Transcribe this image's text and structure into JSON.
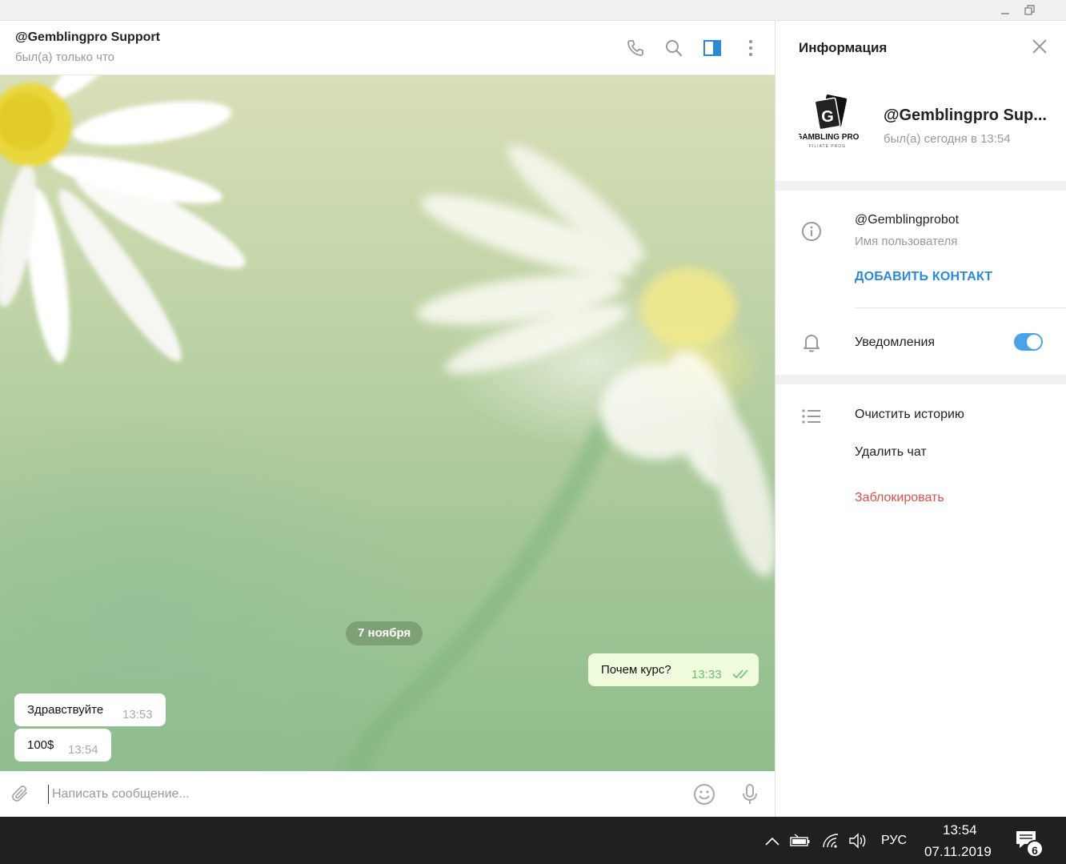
{
  "window": {
    "controls": [
      "minimize-icon",
      "restore-icon"
    ]
  },
  "header": {
    "title": "@Gemblingpro Support",
    "status": "был(а) только что",
    "icons": [
      "phone-icon",
      "search-icon",
      "sidebar-toggle-icon",
      "more-vertical-icon"
    ],
    "accent_color": "#2b8ad8"
  },
  "chat": {
    "date_label": "7 ноября",
    "messages": [
      {
        "direction": "out",
        "text": "Почем курс?",
        "time": "13:33",
        "status": "double-check-icon"
      },
      {
        "direction": "in",
        "text": "Здравствуйте",
        "time": "13:53"
      },
      {
        "direction": "in",
        "text": "100$",
        "time": "13:54"
      }
    ]
  },
  "compose": {
    "placeholder": "Написать сообщение...",
    "icons": [
      "attach-icon",
      "emoji-icon",
      "microphone-icon"
    ]
  },
  "info": {
    "title": "Информация",
    "profile": {
      "name": "@Gemblingpro Sup...",
      "status": "был(а) сегодня в 13:54",
      "avatar_text": "GAMBLING PRO",
      "avatar_sub": "FILIATE PROG"
    },
    "username": {
      "value": "@Gemblingprobot",
      "label": "Имя пользователя",
      "add_contact": "ДОБАВИТЬ КОНТАКТ"
    },
    "notifications": {
      "label": "Уведомления",
      "enabled": true
    },
    "actions": {
      "clear_history": "Очистить историю",
      "delete_chat": "Удалить чат",
      "block": "Заблокировать"
    },
    "danger_color": "#e0504a"
  },
  "taskbar": {
    "language": "РУС",
    "time": "13:54",
    "date": "07.11.2019",
    "notification_count": "6",
    "icons": [
      "chevron-up-icon",
      "battery-icon",
      "wifi-icon",
      "volume-icon",
      "action-center-icon"
    ]
  }
}
